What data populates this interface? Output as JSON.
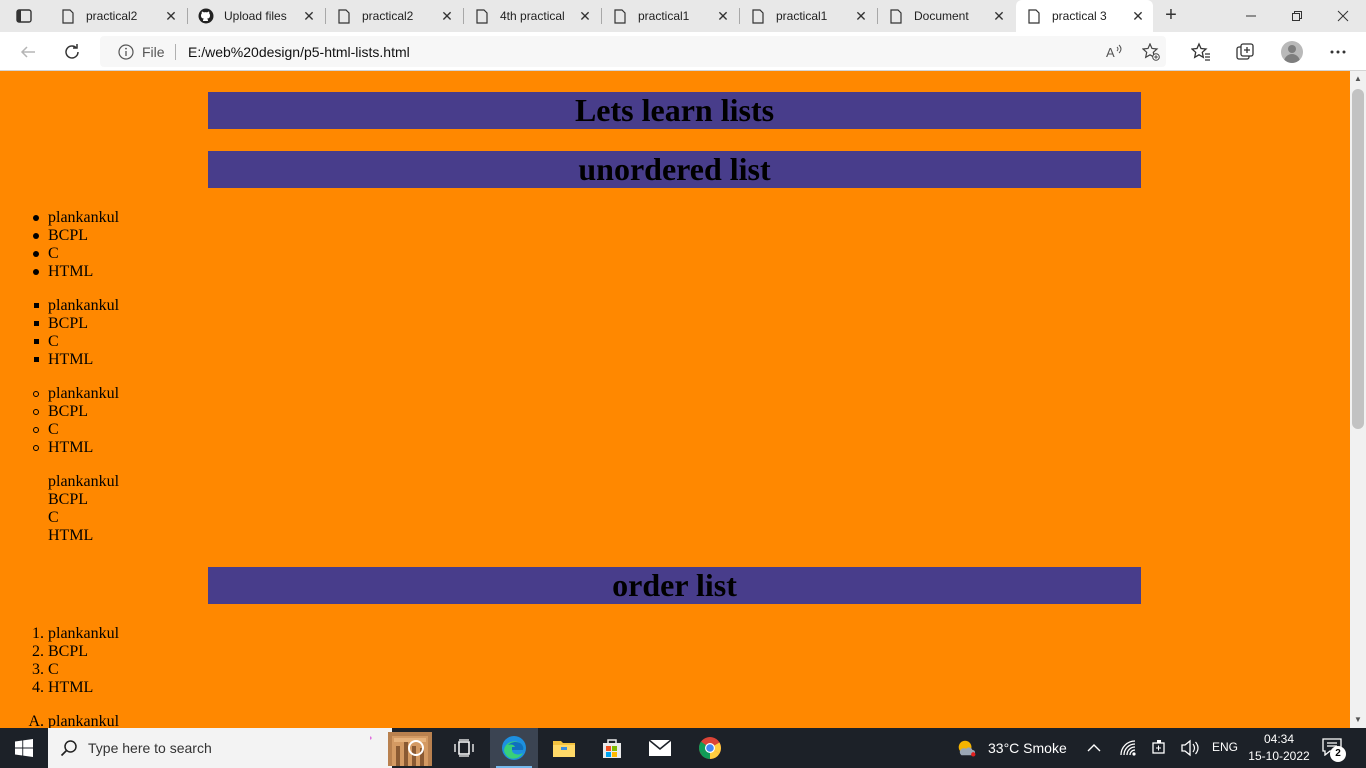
{
  "browser": {
    "tabs": [
      {
        "title": "practical2",
        "icon": "page-icon",
        "active": false
      },
      {
        "title": "Upload files",
        "icon": "github-icon",
        "active": false
      },
      {
        "title": "practical2",
        "icon": "page-icon",
        "active": false
      },
      {
        "title": "4th practical",
        "icon": "page-icon",
        "active": false
      },
      {
        "title": "practical1",
        "icon": "page-icon",
        "active": false
      },
      {
        "title": "practical1",
        "icon": "page-icon",
        "active": false
      },
      {
        "title": "Document",
        "icon": "page-icon",
        "active": false
      },
      {
        "title": "practical 3",
        "icon": "page-icon",
        "active": true
      }
    ],
    "address": {
      "scheme_label": "File",
      "url": "E:/web%20design/p5-html-lists.html"
    }
  },
  "page": {
    "background_color": "#ff8800",
    "heading_color": "#483d8b",
    "title": "Lets learn lists",
    "unordered_heading": "unordered list",
    "ordered_heading": "order list",
    "unordered_lists": [
      {
        "style": "disc",
        "items": [
          "plankankul",
          "BCPL",
          "C",
          "HTML"
        ]
      },
      {
        "style": "square",
        "items": [
          "plankankul",
          "BCPL",
          "C",
          "HTML"
        ]
      },
      {
        "style": "circle",
        "items": [
          "plankankul",
          "BCPL",
          "C",
          "HTML"
        ]
      },
      {
        "style": "none",
        "items": [
          "plankankul",
          "BCPL",
          "C",
          "HTML"
        ]
      }
    ],
    "ordered_lists": [
      {
        "markers": [
          "1.",
          "2.",
          "3.",
          "4."
        ],
        "items": [
          "plankankul",
          "BCPL",
          "C",
          "HTML"
        ]
      },
      {
        "markers": [
          "A."
        ],
        "items": [
          "plankankul"
        ]
      }
    ]
  },
  "taskbar": {
    "search_placeholder": "Type here to search",
    "weather": "33°C  Smoke",
    "language": "ENG",
    "time": "04:34",
    "date": "15-10-2022",
    "notification_count": "2"
  }
}
